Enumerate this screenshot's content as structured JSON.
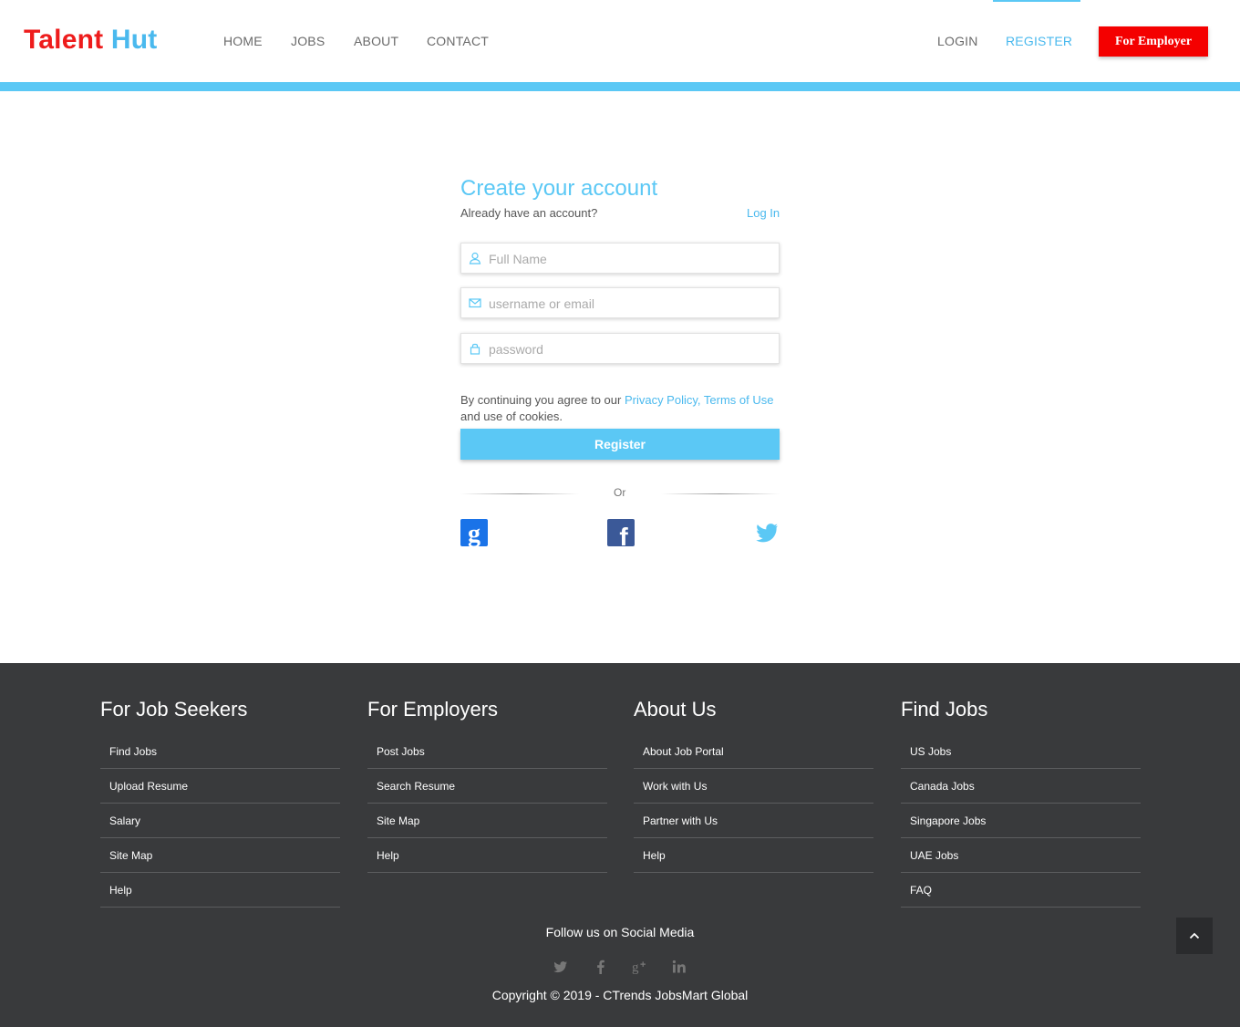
{
  "brand": {
    "part1": "Talent",
    "part2": "Hut"
  },
  "nav": {
    "home": "HOME",
    "jobs": "JOBS",
    "about": "ABOUT",
    "contact": "CONTACT",
    "login": "LOGIN",
    "register": "REGISTER",
    "employer_button": "For Employer"
  },
  "form": {
    "title": "Create your account",
    "already": "Already have an account?",
    "login_link": "Log In",
    "full_name_placeholder": "Full Name",
    "email_placeholder": "username or email",
    "password_placeholder": "password",
    "terms_prefix": "By continuing you agree to our ",
    "terms_links": "Privacy Policy, Terms of Use",
    "terms_suffix": "and use of cookies.",
    "register_button": "Register",
    "or": "Or"
  },
  "footer": {
    "columns": [
      {
        "title": "For Job Seekers",
        "items": [
          "Find Jobs",
          "Upload Resume",
          "Salary",
          "Site Map",
          "Help"
        ]
      },
      {
        "title": "For Employers",
        "items": [
          "Post Jobs",
          "Search Resume",
          "Site Map",
          "Help"
        ]
      },
      {
        "title": "About Us",
        "items": [
          "About Job Portal",
          "Work with Us",
          "Partner with Us",
          "Help"
        ]
      },
      {
        "title": "Find Jobs",
        "items": [
          "US Jobs",
          "Canada Jobs",
          "Singapore Jobs",
          "UAE Jobs",
          "FAQ"
        ]
      }
    ],
    "follow": "Follow us on Social Media",
    "copyright": "Copyright © 2019 - CTrends JobsMart Global"
  },
  "colors": {
    "accent": "#5bc8f5",
    "brand_red": "#ee1c1c",
    "footer_bg": "#393a3c"
  },
  "icons": [
    "user-icon",
    "envelope-icon",
    "lock-icon",
    "google-icon",
    "facebook-icon",
    "twitter-icon",
    "linkedin-icon",
    "google-plus-icon",
    "chevron-up-icon"
  ]
}
